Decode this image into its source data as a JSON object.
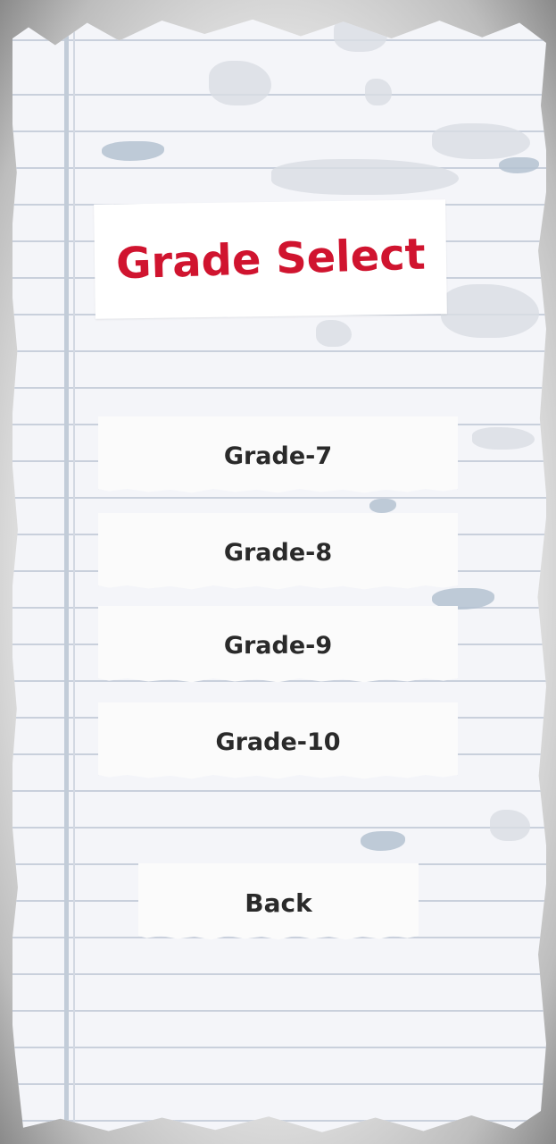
{
  "screen": {
    "title": "Grade Select"
  },
  "grades": [
    {
      "label": "Grade-7"
    },
    {
      "label": "Grade-8"
    },
    {
      "label": "Grade-9"
    },
    {
      "label": "Grade-10"
    }
  ],
  "back": {
    "label": "Back"
  },
  "colors": {
    "title": "#d0142f",
    "button_text": "#2a2a2a",
    "paper": "#f4f5f9",
    "ruled_line": "#c9d0dc"
  }
}
